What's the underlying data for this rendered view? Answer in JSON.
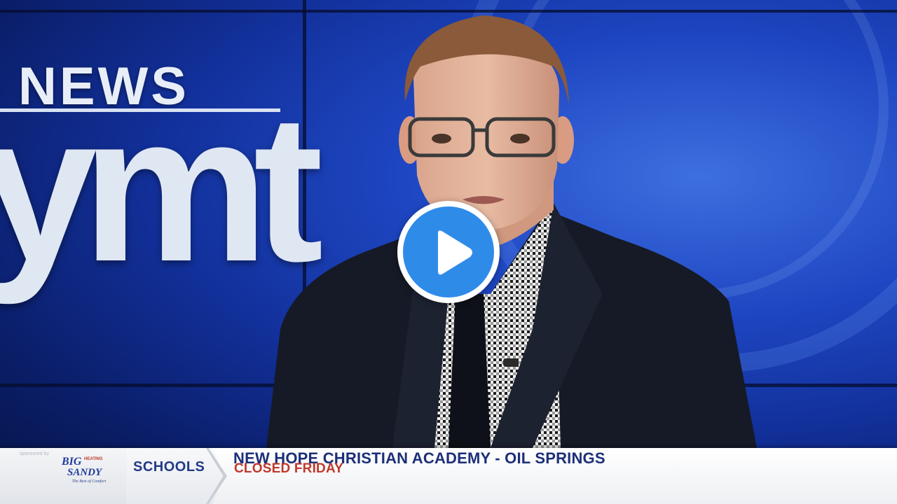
{
  "station_logo": {
    "news_word": "NEWS",
    "call_letters": "ymt"
  },
  "player": {
    "play_button_icon": "play-icon",
    "accent_color": "#2f8be8"
  },
  "lower_third": {
    "sponsor": {
      "caption": "sponsored by",
      "logo_line1": "BIG",
      "logo_line2": "SANDY",
      "logo_small": "HEATING",
      "slogan": "The Best of Comfort"
    },
    "category": "SCHOOLS",
    "headline": "NEW HOPE CHRISTIAN ACADEMY - OIL SPRINGS",
    "status": "CLOSED FRIDAY",
    "headline_color": "#1d2f78",
    "status_color": "#c0392b"
  }
}
